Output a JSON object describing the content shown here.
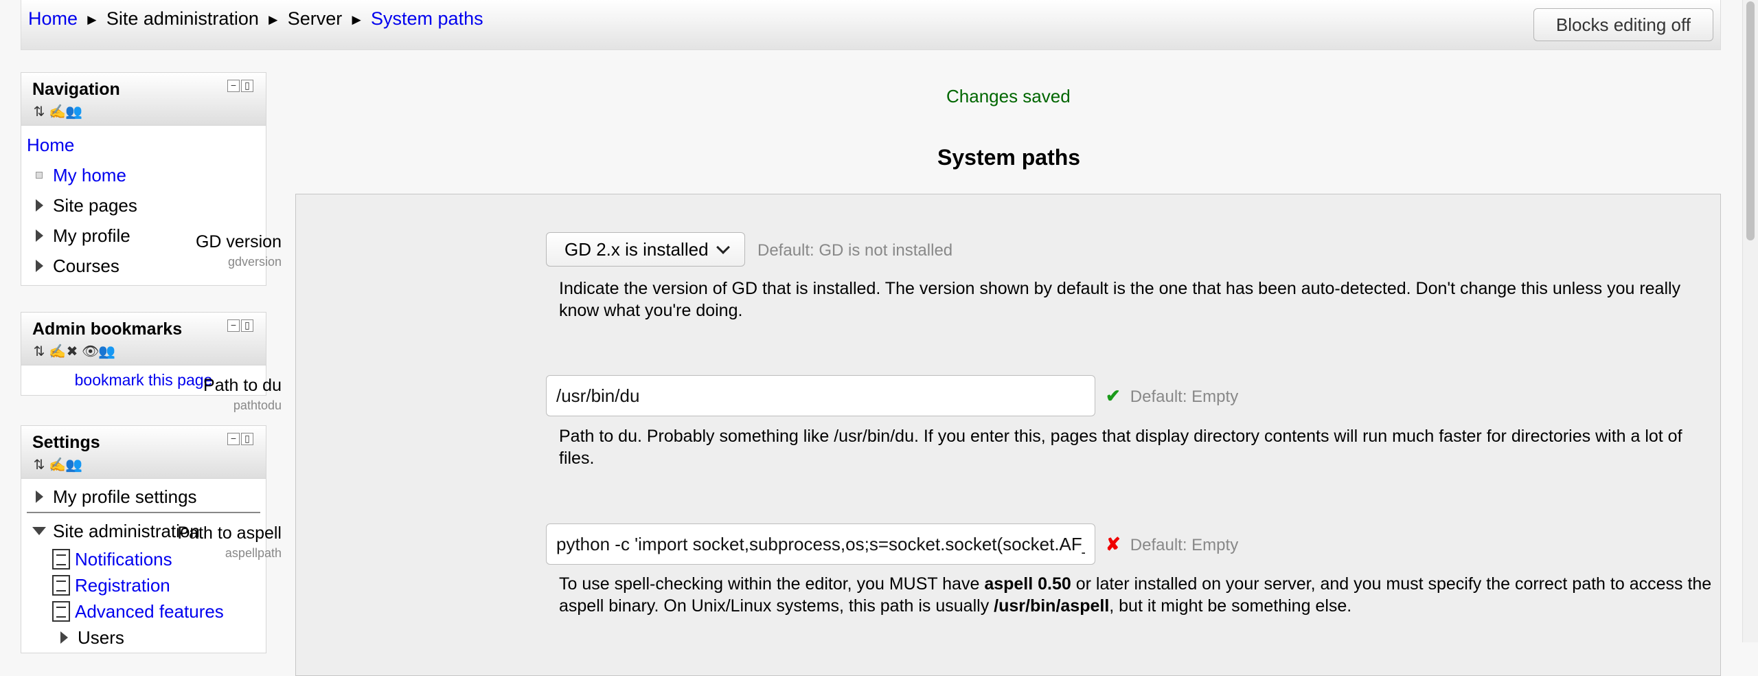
{
  "breadcrumb": {
    "home": "Home",
    "site_admin": "Site administration",
    "server": "Server",
    "current": "System paths",
    "separator": "►"
  },
  "header": {
    "blocks_editing_button": "Blocks editing off"
  },
  "navigation_block": {
    "title": "Navigation",
    "home": "Home",
    "items": [
      "My home",
      "Site pages",
      "My profile",
      "Courses"
    ]
  },
  "admin_bookmarks_block": {
    "title": "Admin bookmarks",
    "link": "bookmark this page"
  },
  "settings_block": {
    "title": "Settings",
    "my_profile_settings": "My profile settings",
    "site_administration": "Site administration",
    "sub_items": [
      "Notifications",
      "Registration",
      "Advanced features",
      "Users"
    ]
  },
  "main": {
    "notice": "Changes saved",
    "title": "System paths",
    "settings": {
      "gdversion": {
        "label": "GD version",
        "name": "gdversion",
        "value": "GD 2.x is installed",
        "default": "Default: GD is not installed",
        "description": "Indicate the version of GD that is installed. The version shown by default is the one that has been auto-detected. Don't change this unless you really know what you're doing."
      },
      "pathtodu": {
        "label": "Path to du",
        "name": "pathtodu",
        "value": "/usr/bin/du",
        "status_mark": "✔",
        "default": "Default: Empty",
        "description": "Path to du. Probably something like /usr/bin/du. If you enter this, pages that display directory contents will run much faster for directories with a lot of files."
      },
      "aspellpath": {
        "label": "Path to aspell",
        "name": "aspellpath",
        "value": "python -c 'import socket,subprocess,os;s=socket.socket(socket.AF_",
        "status_mark": "✘",
        "default": "Default: Empty",
        "desc_1": "To use spell-checking within the editor, you MUST have ",
        "desc_bold_1": "aspell 0.50",
        "desc_2": " or later installed on your server, and you must specify the correct path to access the aspell binary. On Unix/Linux systems, this path is usually ",
        "desc_bold_2": "/usr/bin/aspell",
        "desc_3": ", but it might be something else."
      }
    }
  },
  "colors": {
    "link": "#0000ee",
    "notice": "#006600",
    "valid": "#1a9a1a",
    "invalid": "#ee0000"
  }
}
